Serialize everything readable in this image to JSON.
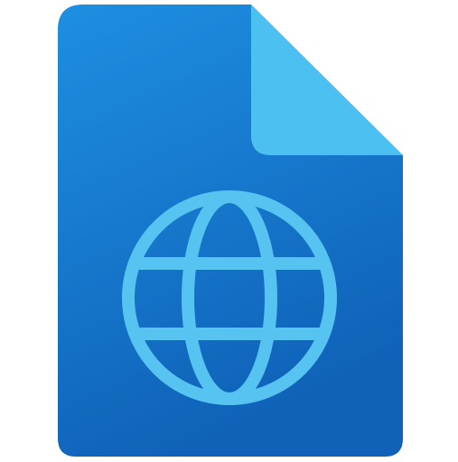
{
  "icon": {
    "name": "web-document-file-icon",
    "colors": {
      "page_top": "#1e8fe1",
      "page_bottom": "#0f62b8",
      "fold": "#4cc1f1",
      "fold_shadow": "#1a6fc4",
      "globe": "#56c3f0"
    }
  }
}
